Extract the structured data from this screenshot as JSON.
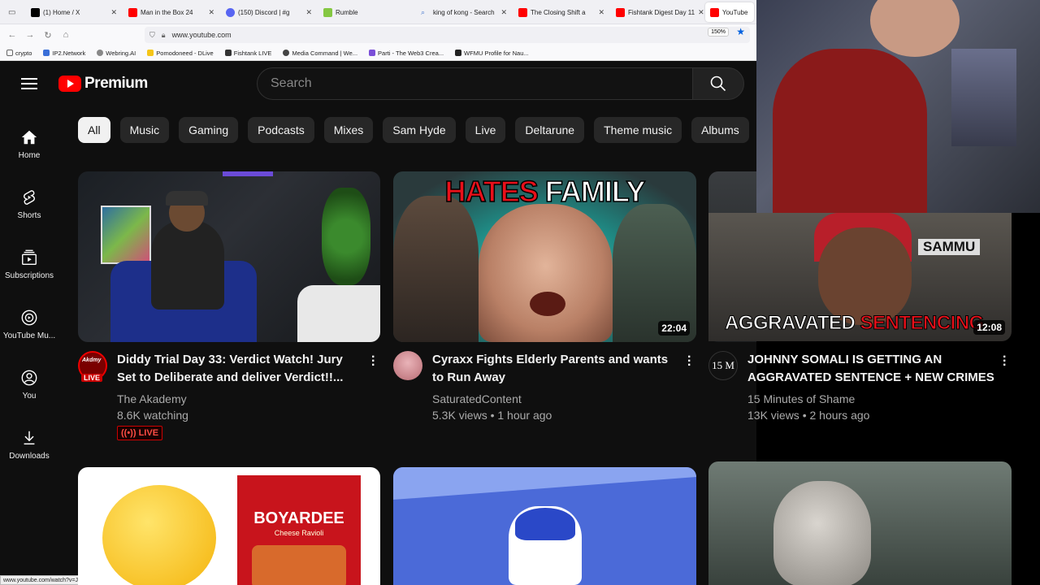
{
  "browser": {
    "tabs": [
      {
        "label": "(1) Home / X",
        "color": "#000000"
      },
      {
        "label": "Man in the Box 24",
        "color": "#ff0000"
      },
      {
        "label": "(150) Discord | #g",
        "color": "#5865f2"
      },
      {
        "label": "Rumble",
        "color": "#85c742"
      },
      {
        "label": "king of kong - Search",
        "color": "#4a7bd0"
      },
      {
        "label": "The Closing Shift a",
        "color": "#ff0000"
      },
      {
        "label": "Fishtank Digest Day 11",
        "color": "#ff0000"
      },
      {
        "label": "YouTube",
        "color": "#ff0000"
      }
    ],
    "url": "www.youtube.com",
    "zoom": "150%",
    "bookmarks": [
      "crypto",
      "IP2.Network",
      "Webring.AI",
      "Pomodoneed - DLive",
      "Fishtank LIVE",
      "Media Command | We...",
      "Parti - The Web3 Crea...",
      "WFMU Profile for Nau..."
    ],
    "status_url": "www.youtube.com/watch?v=JMMx28hbz50"
  },
  "youtube": {
    "brand": "Premium",
    "search_placeholder": "Search",
    "sidebar": [
      {
        "label": "Home",
        "icon": "home-icon"
      },
      {
        "label": "Shorts",
        "icon": "shorts-icon"
      },
      {
        "label": "Subscriptions",
        "icon": "subscriptions-icon"
      },
      {
        "label": "YouTube Mu...",
        "icon": "youtube-music-icon"
      },
      {
        "label": "You",
        "icon": "you-icon"
      },
      {
        "label": "Downloads",
        "icon": "downloads-icon"
      }
    ],
    "chips": [
      "All",
      "Music",
      "Gaming",
      "Podcasts",
      "Mixes",
      "Sam Hyde",
      "Live",
      "Deltarune",
      "Theme music",
      "Albums"
    ],
    "videos": [
      {
        "title": "Diddy Trial Day 33: Verdict Watch! Jury Set to Deliberate and deliver Verdict!!...",
        "channel": "The Akademy",
        "meta": "8.6K watching",
        "badge": "LIVE",
        "avatar_live": "LIVE"
      },
      {
        "title": "Cyraxx Fights Elderly Parents and wants to Run Away",
        "channel": "SaturatedContent",
        "meta": "5.3K views • 1 hour ago",
        "duration": "22:04",
        "thumb_text_a": "HATES",
        "thumb_text_b": "FAMILY"
      },
      {
        "title": "JOHNNY SOMALI IS GETTING AN AGGRAVATED SENTENCE + NEW CRIMES",
        "channel": "15 Minutes of Shame",
        "meta": "13K views • 2 hours ago",
        "duration": "12:08",
        "avatar_text": "15 M",
        "thumb_text_a": "AGGRAVATED",
        "thumb_text_b": "SENTENCING",
        "thumb_tag": "SAMMU"
      }
    ],
    "row2": [
      {
        "brand_logo": "BOYARDEE",
        "brand_sub": "Cheese Ravioli"
      },
      {},
      {}
    ]
  }
}
